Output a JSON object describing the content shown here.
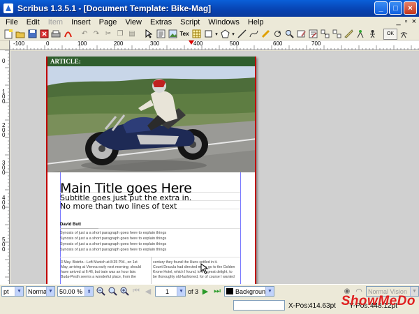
{
  "window": {
    "title": "Scribus 1.3.5.1 - [Document Template: Bike-Mag]",
    "buttons": [
      "_",
      "□",
      "×"
    ]
  },
  "menu": {
    "items": [
      "File",
      "Edit",
      "Item",
      "Insert",
      "Page",
      "View",
      "Extras",
      "Script",
      "Windows",
      "Help"
    ],
    "mdi": [
      "_",
      "▫",
      "×"
    ]
  },
  "toolbar": {
    "icons": [
      "new-icon",
      "open-icon",
      "save-icon",
      "close-icon",
      "print-icon",
      "pdf-icon",
      "undo-icon",
      "redo-icon",
      "cut-icon",
      "copy-icon",
      "paste-icon",
      "select-icon",
      "text-frame-icon",
      "image-frame-icon",
      "render-frame-icon",
      "table-icon",
      "shape-icon",
      "polygon-icon",
      "line-icon",
      "bezier-icon",
      "freehand-icon",
      "rotate-icon",
      "zoom-icon",
      "edit-content-icon",
      "edit-text-icon",
      "link-frames-icon",
      "unlink-frames-icon",
      "measure-icon",
      "copy-props-icon",
      "eyedropper-icon",
      "pdf-tools-icon"
    ],
    "tex_label": "Tex",
    "ok_label": "OK"
  },
  "ruler": {
    "h_numbers": [
      "-100",
      "0",
      "100",
      "200",
      "300",
      "400",
      "500",
      "600",
      "700"
    ],
    "v_numbers": [
      "0",
      "1\n0\n0",
      "2\n0\n0",
      "3\n0\n0",
      "4\n0\n0",
      "5\n0\n0"
    ]
  },
  "page": {
    "header": "ARTICLE:",
    "main_title": "Main Title goes Here",
    "subtitle_1": "Subtitle goes just put the extra in.",
    "subtitle_2": "No more than two lines of text",
    "author": "David Butt",
    "synopsis": [
      "Synosis of just a a short paragraph goes here to explain things",
      "Synosis of just a a short paragraph goes here to explain things",
      "Synosis of just a a short paragraph goes here to explain things",
      "Synosis of just a a short paragraph goes here to explain things"
    ],
    "col1": [
      "3 May. Bistritz.--Left Munich at 8:35 P.M., on 1st",
      "May, arriving at Vienna early next morning; should",
      "have arrived at 6:46, but train was an hour late.",
      "Buda-Pesth seems a wonderful place, from the"
    ],
    "col2": [
      "century they found the Huns settled in it.",
      "Count Dracula had directed me to go to the Golden",
      "Krone Hotel, which I found, to my great delight, to",
      "be thoroughly old-fashioned, for of course I wanted"
    ]
  },
  "statusbar": {
    "unit": "pt",
    "mode": "Normal",
    "zoom": "50.00 %",
    "page_num": "1",
    "page_of": "of 3",
    "layer": "Background",
    "vision": "Normal Vision"
  },
  "coords": {
    "x_label": "X-Pos:",
    "x_value": "414.63pt",
    "y_label": "Y-Pos:",
    "y_value": "448.12pt"
  },
  "watermark": "ShowMeDo",
  "colors": {
    "title_blue": "#0842b0",
    "header_green": "#2f5e2e",
    "page_border_red": "#c00000",
    "watermark_red": "#e02020"
  }
}
